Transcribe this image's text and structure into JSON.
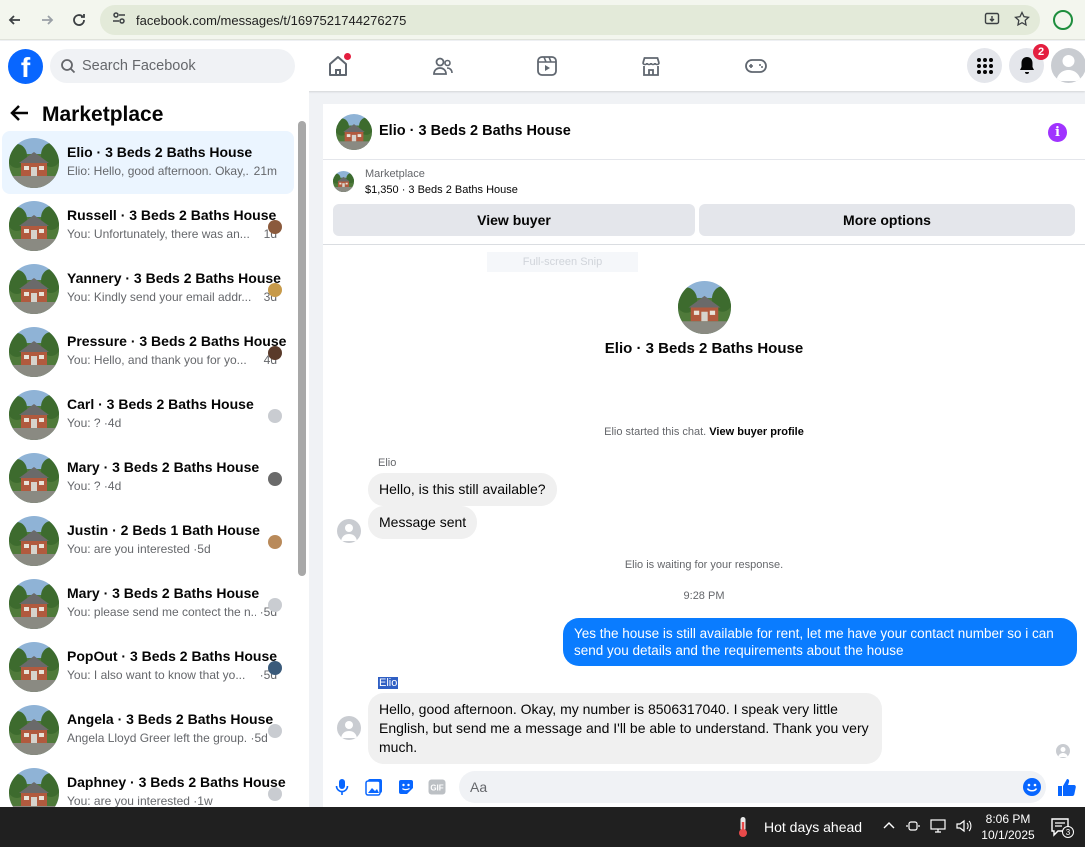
{
  "browser": {
    "url": "facebook.com/messages/t/1697521744276275",
    "icons": [
      "back-arrow-icon",
      "forward-arrow-icon",
      "reload-icon",
      "site-settings-icon",
      "install-app-icon",
      "star-icon",
      "profile-icon"
    ]
  },
  "header": {
    "search_placeholder": "Search Facebook",
    "notification_count": "2",
    "colors": {
      "brand": "#0866ff",
      "badge": "#e41e3f"
    }
  },
  "left": {
    "title": "Marketplace",
    "conversations": [
      {
        "title": "Elio · 3 Beds 2 Baths House",
        "snippet": "Elio: Hello, good afternoon. Okay,...",
        "time": "21m"
      },
      {
        "title": "Russell · 3 Beds 2 Baths House",
        "snippet": "You: Unfortunately, there was an...",
        "time": "1d"
      },
      {
        "title": "Yannery · 3 Beds 2 Baths House",
        "snippet": "You: Kindly send your email addr...",
        "time": "3d"
      },
      {
        "title": "Pressure · 3 Beds 2 Baths House",
        "snippet": "You: Hello, and thank you for yo...",
        "time": "4d"
      },
      {
        "title": "Carl · 3 Beds 2 Baths House",
        "snippet": "You: ? ·4d",
        "time": ""
      },
      {
        "title": "Mary · 3 Beds 2 Baths House",
        "snippet": "You: ? ·4d",
        "time": ""
      },
      {
        "title": "Justin · 2 Beds 1 Bath House",
        "snippet": "You: are you interested ·5d",
        "time": ""
      },
      {
        "title": "Mary · 3 Beds 2 Baths House",
        "snippet": "You: please send me contect the n...",
        "time": "·5d"
      },
      {
        "title": "PopOut · 3 Beds 2 Baths House",
        "snippet": "You: I also want to know that yo...",
        "time": "·5d"
      },
      {
        "title": "Angela · 3 Beds 2 Baths House",
        "snippet": "Angela Lloyd Greer left the group. ·5d",
        "time": ""
      },
      {
        "title": "Daphney · 3 Beds 2 Baths House",
        "snippet": "You: are you interested ·1w",
        "time": ""
      }
    ]
  },
  "chat": {
    "title": "Elio · 3 Beds 2 Baths House",
    "listing_category": "Marketplace",
    "listing_price_title": "$1,350 · 3 Beds 2 Baths House",
    "view_buyer": "View buyer",
    "more_options": "More options",
    "snip_label": "Full-screen Snip",
    "hero_title": "Elio · 3 Beds 2 Baths House",
    "started_text": "Elio started this chat. ",
    "view_buyer_profile": "View buyer profile",
    "sender1": "Elio",
    "msg1": "Hello, is this still available?",
    "msg2": "Message sent",
    "waiting": "Elio is waiting for your response.",
    "time": "9:28 PM",
    "msg3": "Yes the house is still available for rent, let me have your contact number so i can send you details and the requirements about the house",
    "sender2": "Elio",
    "msg4": "Hello, good afternoon. Okay, my number is 8506317040. I speak very little English, but send me a message and I'll be able to understand. Thank you very much.",
    "composer_placeholder": "Aa",
    "colors": {
      "outgoing": "#0a7cff",
      "info": "#a033ff"
    }
  },
  "taskbar": {
    "weather": "Hot days ahead",
    "time": "8:06 PM",
    "date": "10/1/2025",
    "notification_count": "3"
  }
}
